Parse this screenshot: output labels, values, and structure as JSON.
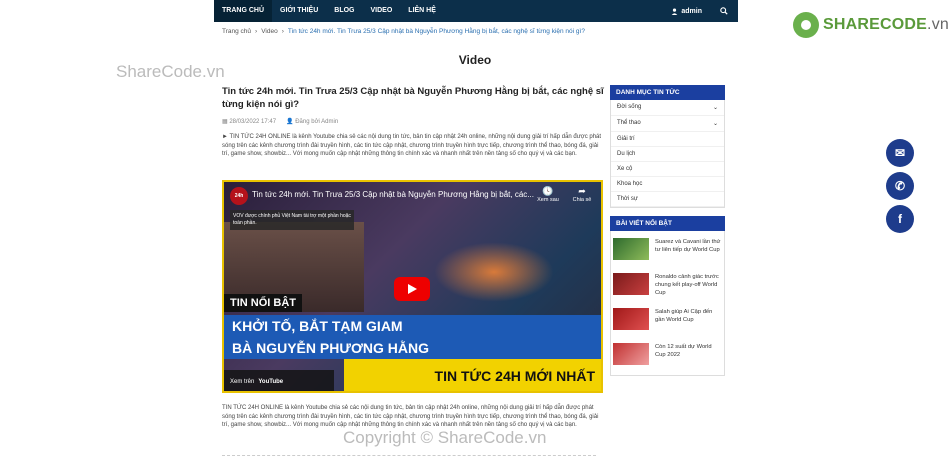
{
  "topbar": {
    "nav": [
      "TRANG CHỦ",
      "GIỚI THIỆU",
      "BLOG",
      "VIDEO",
      "LIÊN HỆ"
    ],
    "user": "admin"
  },
  "logo": {
    "brand": "SHARECODE",
    "suffix": ".vn"
  },
  "breadcrumb": {
    "home": "Trang chủ",
    "section": "Video",
    "current": "Tin tức 24h mới. Tin Trưa 25/3 Cập nhật bà Nguyễn Phương Hằng bị bắt, các nghệ sĩ từng kiện nói gì?"
  },
  "page_title": "Video",
  "watermark_top": "ShareCode.vn",
  "watermark_bottom": "Copyright © ShareCode.vn",
  "article": {
    "title": "Tin tức 24h mới. Tin Trưa 25/3 Cập nhật bà Nguyễn Phương Hằng bị bắt, các nghệ sĩ từng kiện nói gì?",
    "date": "28/03/2022 17:47",
    "author": "Đăng bởi Admin",
    "intro": "► TIN TỨC 24H ONLINE là kênh Youtube chia sẻ các nội dung tin tức, bản tin cập nhật 24h online, những nội dung giải trí hấp dẫn được phát sóng trên các kênh chương trình đài truyền hình, các tin tức cập nhật, chương trình truyền hình trực tiếp, chương trình thể thao, bóng đá, giải trí, game show, showbiz... Với mong muốn cập nhật những thông tin chính xác và nhanh nhất trên nền tảng số cho quý vị và các bạn.",
    "body": "TIN TỨC 24H ONLINE là kênh Youtube chia sẻ các nội dung tin tức, bản tin cập nhật 24h online, những nội dung giải trí hấp dẫn được phát sóng trên các kênh chương trình đài truyền hình, các tin tức cập nhật, chương trình truyền hình trực tiếp, chương trình thể thao, bóng đá, giải trí, game show, showbiz... Với mong muốn cập nhật những thông tin chính xác và nhanh nhất trên nền tảng số cho quý vị và các bạn."
  },
  "video": {
    "channel": "24h",
    "title": "Tin tức 24h mới. Tin Trưa 25/3 Cập nhật bà Nguyễn Phương Hằng bị bắt, các...",
    "watch_later": "Xem sau",
    "share": "Chia sẻ",
    "vov_notice": "VOV được chính phủ Việt Nam tài trợ một phần hoặc toàn phần.",
    "tag": "TIN NỔI BẬT",
    "line1": "KHỞI TỐ, BẮT TẠM GIAM",
    "line2": "BÀ NGUYỄN PHƯƠNG HẰNG",
    "line3": "TIN TỨC 24H MỚI NHẤT",
    "watch_on": "Xem trên",
    "youtube": "YouTube"
  },
  "sidebar": {
    "categories_title": "DANH MỤC TIN TỨC",
    "categories": [
      "Đời sống",
      "Thể thao",
      "Giải trí",
      "Du lịch",
      "Xe cộ",
      "Khoa học",
      "Thời sự"
    ],
    "featured_title": "BÀI VIẾT NỔI BẬT",
    "featured": [
      "Suarez và Cavani lần thứ tư liên tiếp dự World Cup",
      "Ronaldo cảnh giác trước chung kết play-off World Cup",
      "Salah giúp Ai Cập đến gần World Cup",
      "Còn 12 suất dự World Cup 2022"
    ]
  },
  "colors": {
    "nav_bg": "#0c2f4a",
    "sidebar_head": "#1b3fa0",
    "fab": "#1e3c8c",
    "brand_green": "#5a9a3a"
  }
}
